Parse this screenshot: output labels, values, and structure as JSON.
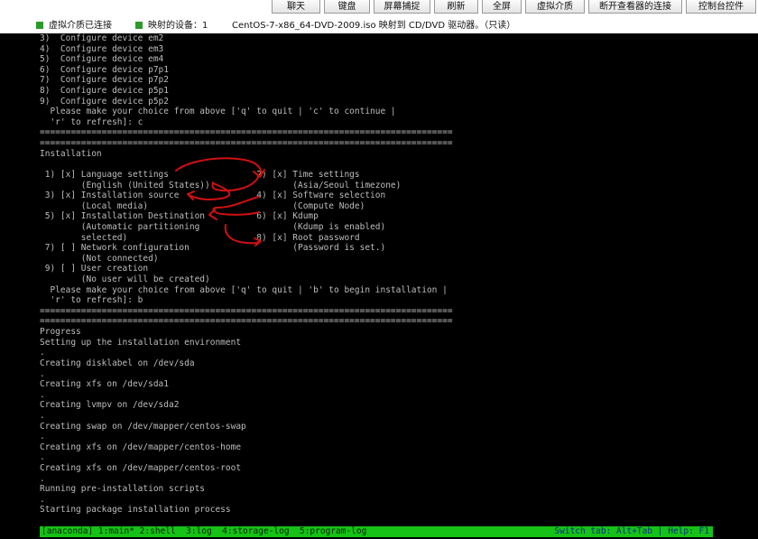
{
  "toolbar": {
    "buttons": [
      "聊天",
      "键盘",
      "屏幕捕捉",
      "刷新",
      "全屏",
      "虚拟介质",
      "断开查看器的连接",
      "控制台控件"
    ]
  },
  "status": {
    "media_label": "虚拟介质已连接",
    "mapped_devices_label": "映射的设备：",
    "mapped_devices_count": "1",
    "iso_message": "CentOS-7-x86_64-DVD-2009.iso 映射到 CD/DVD 驱动器。（只读）",
    "indicator_color": "#2a9a2a"
  },
  "console": {
    "lines": [
      "3)  Configure device em2",
      "4)  Configure device em3",
      "5)  Configure device em4",
      "6)  Configure device p7p1",
      "7)  Configure device p7p2",
      "8)  Configure device p5p1",
      "9)  Configure device p5p2",
      "  Please make your choice from above ['q' to quit | 'c' to continue |",
      "  'r' to refresh]: c",
      "================================================================================",
      "================================================================================",
      "Installation",
      "",
      " 1) [x] Language settings                 2) [x] Time settings",
      "        (English (United States))                (Asia/Seoul timezone)",
      " 3) [x] Installation source               4) [x] Software selection",
      "        (Local media)                            (Compute Node)",
      " 5) [x] Installation Destination          6) [x] Kdump",
      "        (Automatic partitioning                  (Kdump is enabled)",
      "        selected)                         8) [x] Root password",
      " 7) [ ] Network configuration                    (Password is set.)",
      "        (Not connected)",
      " 9) [ ] User creation",
      "        (No user will be created)",
      "  Please make your choice from above ['q' to quit | 'b' to begin installation |",
      "  'r' to refresh]: b",
      "================================================================================",
      "================================================================================",
      "Progress",
      "Setting up the installation environment",
      ".",
      "Creating disklabel on /dev/sda",
      ".",
      "Creating xfs on /dev/sda1",
      ".",
      "Creating lvmpv on /dev/sda2",
      ".",
      "Creating swap on /dev/mapper/centos-swap",
      ".",
      "Creating xfs on /dev/mapper/centos-home",
      ".",
      "Creating xfs on /dev/mapper/centos-root",
      ".",
      "Running pre-installation scripts",
      ".",
      "Starting package installation process"
    ],
    "text_color": "#bdbdbd",
    "background": "#000000",
    "annotation_color": "#d01010"
  },
  "tmux": {
    "left": "[anaconda] 1:main* 2:shell  3:log  4:storage-log  5:program-log",
    "right": "Switch tab: Alt+Tab | Help: F1",
    "bar_color": "#15c215"
  }
}
